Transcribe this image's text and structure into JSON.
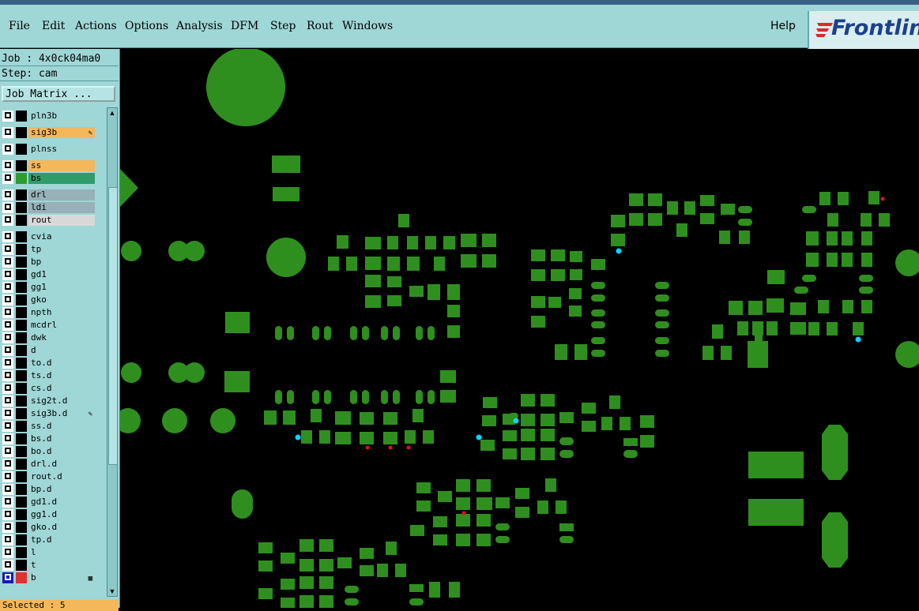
{
  "menu": {
    "items": [
      {
        "label": "File",
        "name": "menu-file"
      },
      {
        "label": "Edit",
        "name": "menu-edit"
      },
      {
        "label": "Actions",
        "name": "menu-actions"
      },
      {
        "label": "Options",
        "name": "menu-options"
      },
      {
        "label": "Analysis",
        "name": "menu-analysis"
      },
      {
        "label": "DFM",
        "name": "menu-dfm"
      },
      {
        "label": "Step",
        "name": "menu-step"
      },
      {
        "label": "Rout",
        "name": "menu-rout"
      },
      {
        "label": "Windows",
        "name": "menu-windows"
      }
    ],
    "help": "Help"
  },
  "logo": {
    "text": "Frontlin"
  },
  "panel": {
    "job": "Job : 4x0ck04ma0",
    "step": "Step: cam",
    "job_matrix": "Job Matrix ...",
    "selected": "Selected : 5",
    "layers": [
      {
        "name": "pln3b",
        "color": "#9fd6d6",
        "swatch": "#000"
      },
      {
        "name": "sig3b",
        "color": "#f4b75a",
        "swatch": "#000",
        "flag": "pen"
      },
      {
        "name": "plnss",
        "color": "#9fd6d6",
        "swatch": "#000"
      },
      {
        "name": "ss",
        "color": "#f4b75a",
        "swatch": "#000"
      },
      {
        "name": "bs",
        "color": "#2f9c6a",
        "swatch": "#2f9c2f"
      },
      {
        "name": "drl",
        "color": "#98b0b8",
        "swatch": "#000"
      },
      {
        "name": "ldi",
        "color": "#98b0b8",
        "swatch": "#000"
      },
      {
        "name": "rout",
        "color": "#d8d8d8",
        "swatch": "#000"
      },
      {
        "name": "cvia",
        "color": "#9fd6d6",
        "swatch": "#000"
      },
      {
        "name": "tp",
        "color": "#9fd6d6",
        "swatch": "#000"
      },
      {
        "name": "bp",
        "color": "#9fd6d6",
        "swatch": "#000"
      },
      {
        "name": "gd1",
        "color": "#9fd6d6",
        "swatch": "#000"
      },
      {
        "name": "gg1",
        "color": "#9fd6d6",
        "swatch": "#000"
      },
      {
        "name": "gko",
        "color": "#9fd6d6",
        "swatch": "#000"
      },
      {
        "name": "npth",
        "color": "#9fd6d6",
        "swatch": "#000"
      },
      {
        "name": "mcdrl",
        "color": "#9fd6d6",
        "swatch": "#000"
      },
      {
        "name": "dwk",
        "color": "#9fd6d6",
        "swatch": "#000"
      },
      {
        "name": "d",
        "color": "#9fd6d6",
        "swatch": "#000"
      },
      {
        "name": "to.d",
        "color": "#9fd6d6",
        "swatch": "#000"
      },
      {
        "name": "ts.d",
        "color": "#9fd6d6",
        "swatch": "#000"
      },
      {
        "name": "cs.d",
        "color": "#9fd6d6",
        "swatch": "#000"
      },
      {
        "name": "sig2t.d",
        "color": "#9fd6d6",
        "swatch": "#000"
      },
      {
        "name": "sig3b.d",
        "color": "#9fd6d6",
        "swatch": "#000",
        "flag": "pen"
      },
      {
        "name": "ss.d",
        "color": "#9fd6d6",
        "swatch": "#000"
      },
      {
        "name": "bs.d",
        "color": "#9fd6d6",
        "swatch": "#000"
      },
      {
        "name": "bo.d",
        "color": "#9fd6d6",
        "swatch": "#000"
      },
      {
        "name": "drl.d",
        "color": "#9fd6d6",
        "swatch": "#000"
      },
      {
        "name": "rout.d",
        "color": "#9fd6d6",
        "swatch": "#000"
      },
      {
        "name": "bp.d",
        "color": "#9fd6d6",
        "swatch": "#000"
      },
      {
        "name": "gd1.d",
        "color": "#9fd6d6",
        "swatch": "#000"
      },
      {
        "name": "gg1.d",
        "color": "#9fd6d6",
        "swatch": "#000"
      },
      {
        "name": "gko.d",
        "color": "#9fd6d6",
        "swatch": "#000"
      },
      {
        "name": "tp.d",
        "color": "#9fd6d6",
        "swatch": "#000"
      },
      {
        "name": "l",
        "color": "#9fd6d6",
        "swatch": "#000"
      },
      {
        "name": "t",
        "color": "#9fd6d6",
        "swatch": "#000"
      },
      {
        "name": "b",
        "color": "#9fd6d6",
        "swatch": "#000",
        "flag": "grid",
        "active": true
      }
    ]
  },
  "colors": {
    "pad": "#2f8f1e",
    "via_marker": "#00d8ff",
    "error_marker": "#e01010",
    "panel_bg": "#9fd6d6"
  }
}
